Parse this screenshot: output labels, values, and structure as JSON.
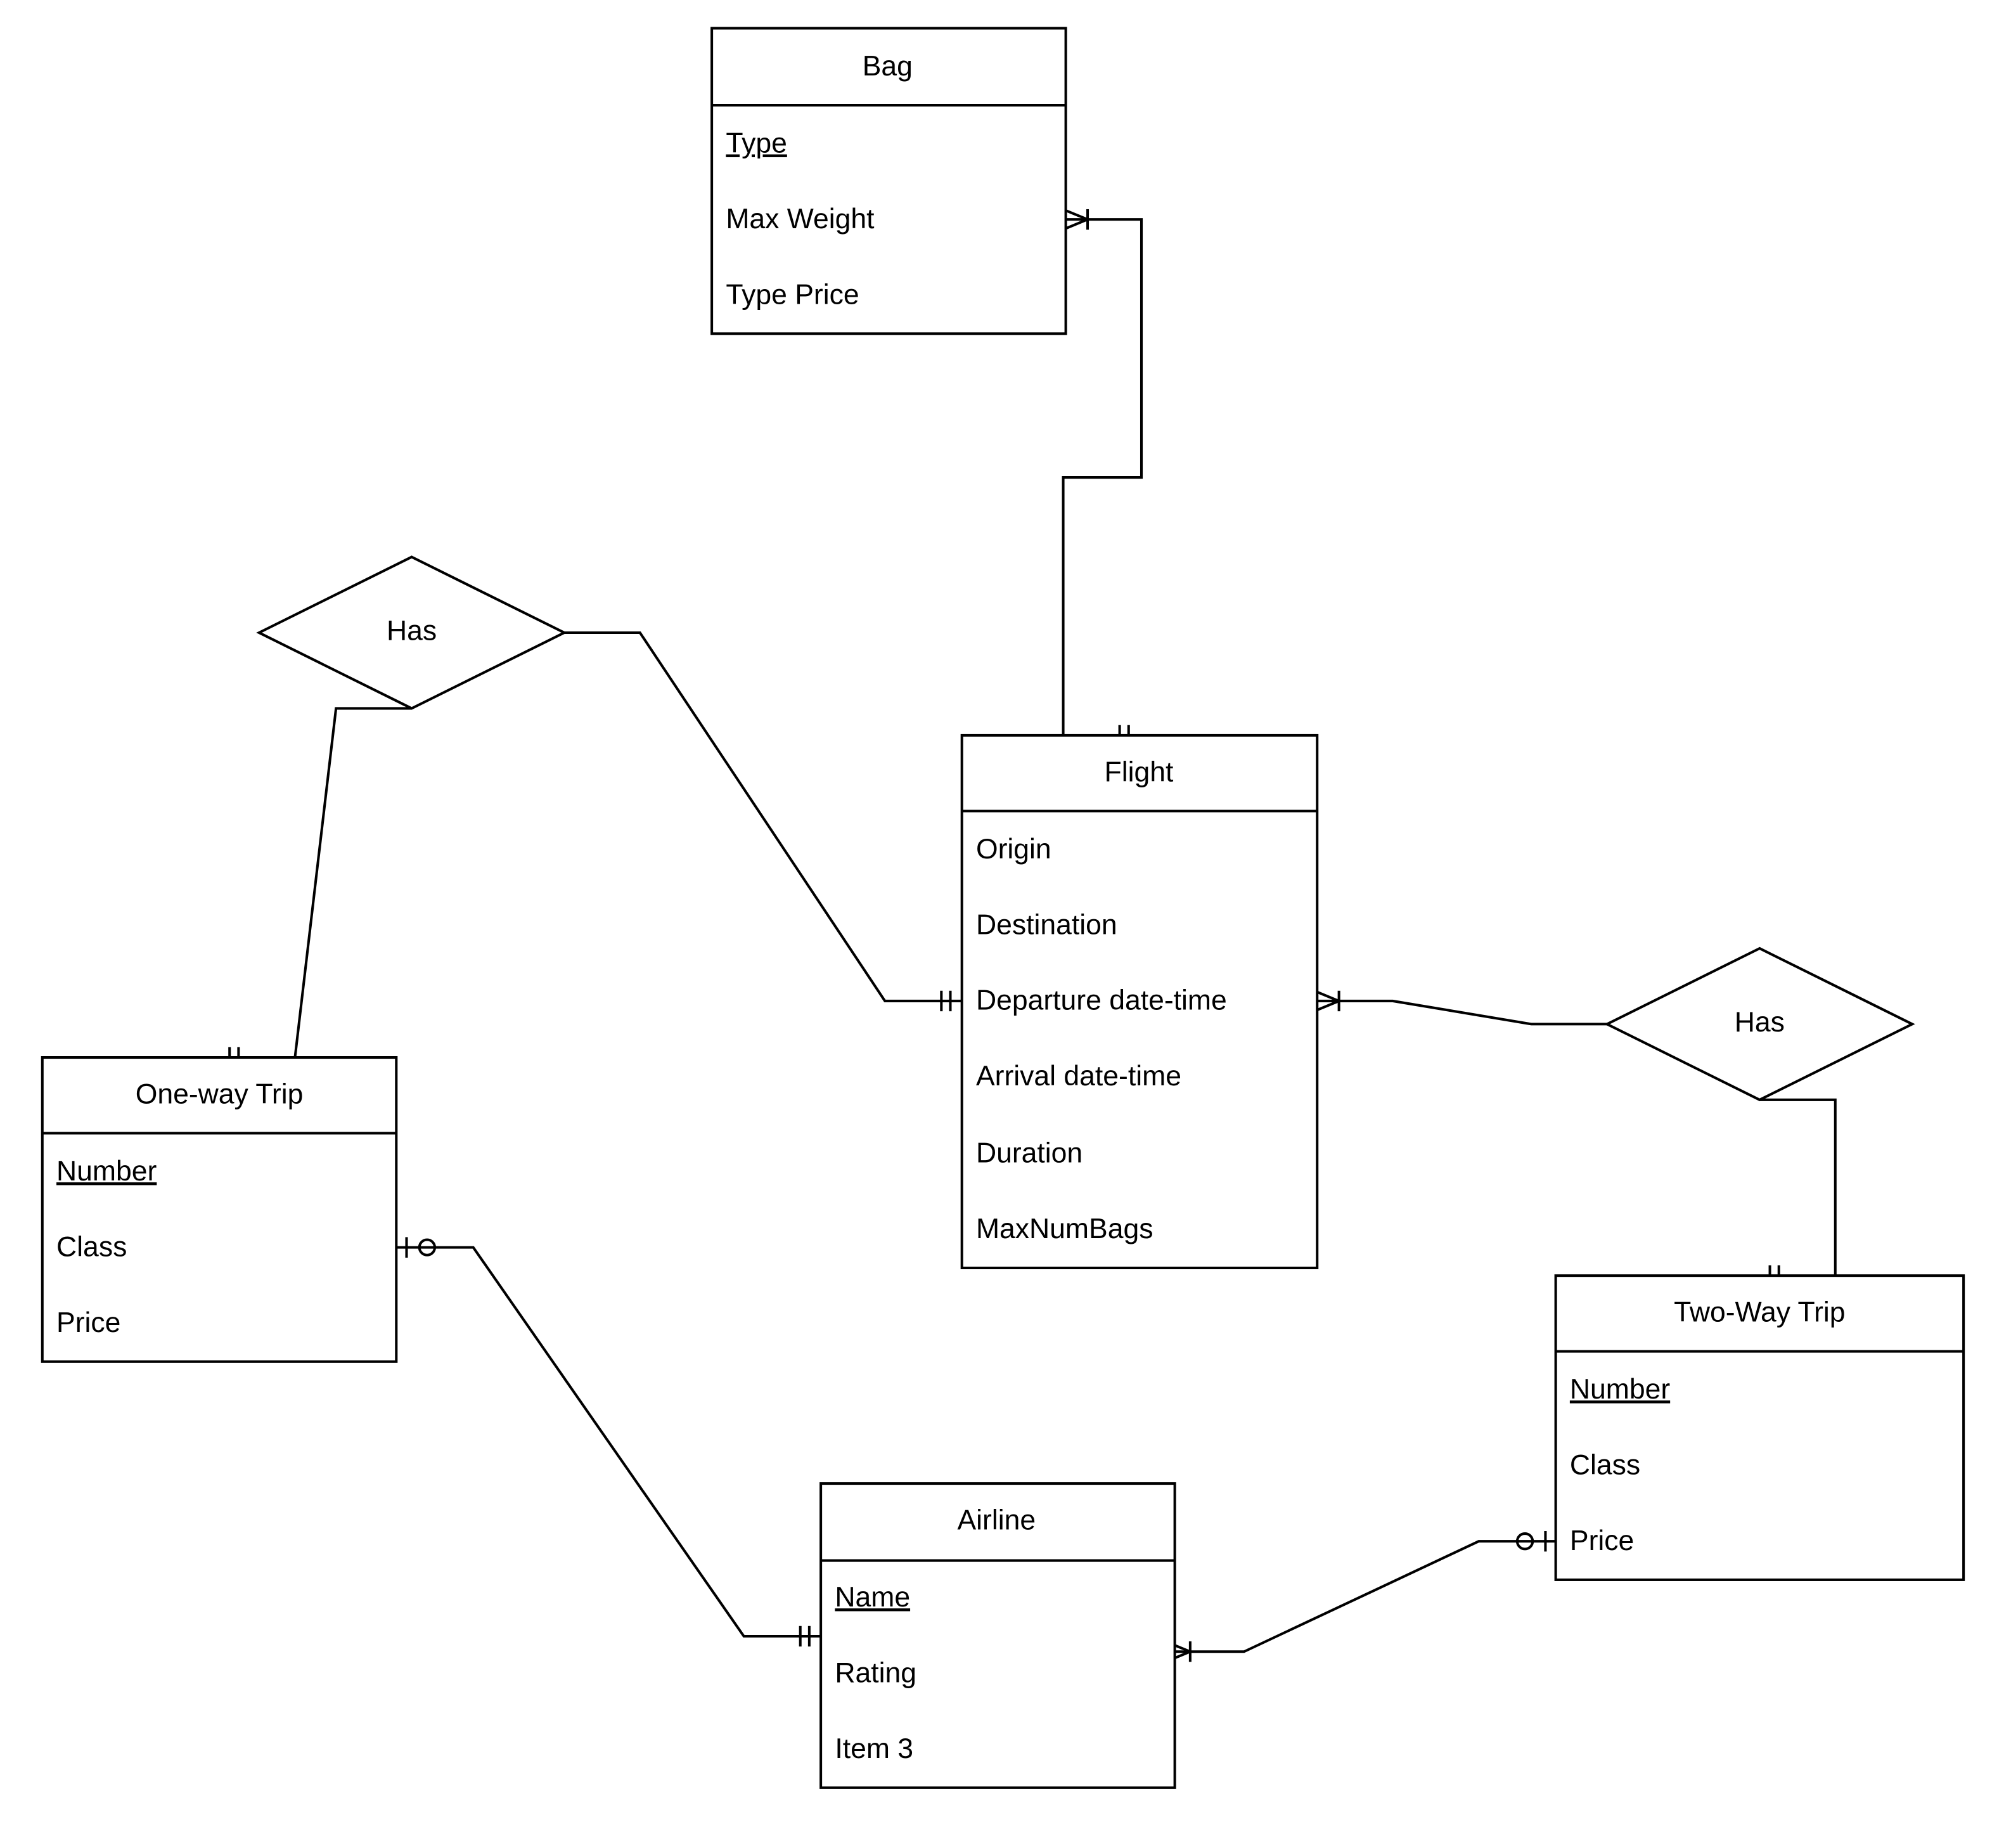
{
  "diagram": {
    "type": "er-diagram",
    "entities": [
      {
        "id": "bag",
        "title": "Bag",
        "attributes": [
          {
            "label": "Type",
            "key": true
          },
          {
            "label": "Max Weight",
            "key": false
          },
          {
            "label": "Type Price",
            "key": false
          }
        ]
      },
      {
        "id": "flight",
        "title": "Flight",
        "attributes": [
          {
            "label": "Origin",
            "key": false
          },
          {
            "label": "Destination",
            "key": false
          },
          {
            "label": "Departure date-time",
            "key": false
          },
          {
            "label": "Arrival date-time",
            "key": false
          },
          {
            "label": "Duration",
            "key": false
          },
          {
            "label": "MaxNumBags",
            "key": false
          }
        ]
      },
      {
        "id": "one_way_trip",
        "title": "One-way Trip",
        "attributes": [
          {
            "label": "Number",
            "key": true
          },
          {
            "label": "Class",
            "key": false
          },
          {
            "label": "Price",
            "key": false
          }
        ]
      },
      {
        "id": "two_way_trip",
        "title": "Two-Way Trip",
        "attributes": [
          {
            "label": "Number",
            "key": true
          },
          {
            "label": "Class",
            "key": false
          },
          {
            "label": "Price",
            "key": false
          }
        ]
      },
      {
        "id": "airline",
        "title": "Airline",
        "attributes": [
          {
            "label": "Name",
            "key": true
          },
          {
            "label": "Rating",
            "key": false
          },
          {
            "label": "Item 3",
            "key": false
          }
        ]
      }
    ],
    "relationships": [
      {
        "id": "has_left",
        "label": "Has"
      },
      {
        "id": "has_right",
        "label": "Has"
      }
    ],
    "connectors": [
      {
        "from": "bag",
        "from_end": "one-or-many",
        "to": "flight",
        "to_end": "exactly-one"
      },
      {
        "from": "has_left",
        "from_end": "none",
        "to": "flight",
        "to_end": "exactly-one"
      },
      {
        "from": "has_left",
        "from_end": "none",
        "to": "one_way_trip",
        "to_end": "exactly-one"
      },
      {
        "from": "flight",
        "from_end": "one-or-many",
        "to": "has_right",
        "to_end": "none"
      },
      {
        "from": "has_right",
        "from_end": "none",
        "to": "two_way_trip",
        "to_end": "exactly-one"
      },
      {
        "from": "one_way_trip",
        "from_end": "zero-or-one",
        "to": "airline",
        "to_end": "exactly-one"
      },
      {
        "from": "airline",
        "from_end": "one-or-many",
        "to": "two_way_trip",
        "to_end": "zero-or-one"
      }
    ]
  }
}
